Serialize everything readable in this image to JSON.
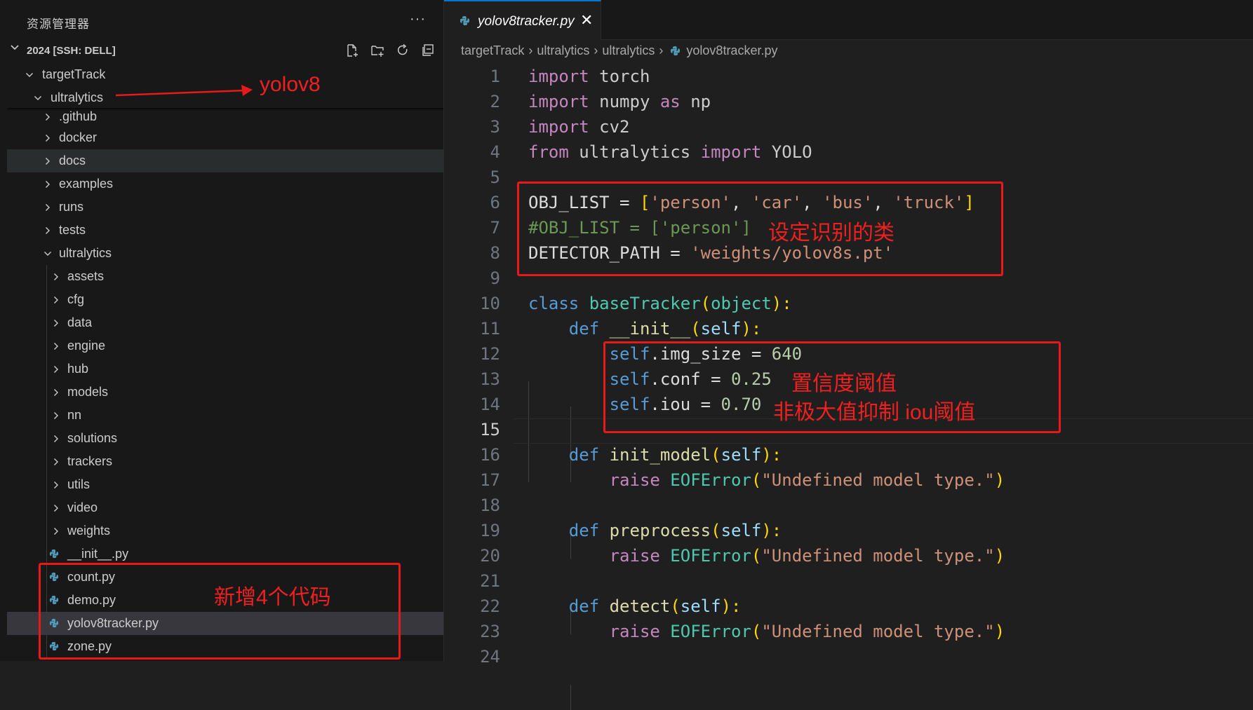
{
  "sidebar": {
    "title": "资源管理器",
    "more": "···",
    "section": "2024 [SSH: DELL]",
    "tree": [
      {
        "label": "targetTrack",
        "expanded": true
      },
      {
        "label": "ultralytics",
        "expanded": true
      },
      {
        "label": ".github"
      },
      {
        "label": "docker"
      },
      {
        "label": "docs"
      },
      {
        "label": "examples"
      },
      {
        "label": "runs"
      },
      {
        "label": "tests"
      },
      {
        "label": "ultralytics",
        "expanded": true
      },
      {
        "label": "assets"
      },
      {
        "label": "cfg"
      },
      {
        "label": "data"
      },
      {
        "label": "engine"
      },
      {
        "label": "hub"
      },
      {
        "label": "models"
      },
      {
        "label": "nn"
      },
      {
        "label": "solutions"
      },
      {
        "label": "trackers"
      },
      {
        "label": "utils"
      },
      {
        "label": "video"
      },
      {
        "label": "weights"
      },
      {
        "label": "__init__.py"
      },
      {
        "label": "count.py"
      },
      {
        "label": "demo.py"
      },
      {
        "label": "yolov8tracker.py"
      },
      {
        "label": "zone.py"
      }
    ]
  },
  "editor": {
    "tab": {
      "label": "yolov8tracker.py",
      "close": "✕"
    },
    "breadcrumb": [
      "targetTrack",
      "ultralytics",
      "ultralytics",
      "yolov8tracker.py"
    ],
    "lines": [
      "1",
      "2",
      "3",
      "4",
      "5",
      "6",
      "7",
      "8",
      "9",
      "10",
      "11",
      "12",
      "13",
      "14",
      "15",
      "16",
      "17",
      "18",
      "19",
      "20",
      "21",
      "22",
      "23",
      "24"
    ],
    "code": {
      "l1a": "import",
      "l1b": " torch",
      "l2a": "import",
      "l2b": " numpy ",
      "l2c": "as",
      "l2d": " np",
      "l3a": "import",
      "l3b": " cv2",
      "l4a": "from",
      "l4b": " ultralytics ",
      "l4c": "import",
      "l4d": " YOLO",
      "l6a": "OBJ_LIST = ",
      "l6b": "[",
      "l6c": "'person'",
      "l6d": ", ",
      "l6e": "'car'",
      "l6f": ", ",
      "l6g": "'bus'",
      "l6h": ", ",
      "l6i": "'truck'",
      "l6j": "]",
      "l7": "#OBJ_LIST = ['person']",
      "l8a": "DETECTOR_PATH = ",
      "l8b": "'weights/yolov8s.pt'",
      "l10a": "class",
      "l10b": " baseTracker",
      "l10c": "(",
      "l10d": "object",
      "l10e": "):",
      "l11a": "def",
      "l11b": " __init__",
      "l11c": "(",
      "l11d": "self",
      "l11e": "):",
      "l12a": "self",
      "l12b": ".img_size = ",
      "l12c": "640",
      "l13a": "self",
      "l13b": ".conf = ",
      "l13c": "0.25",
      "l14a": "self",
      "l14b": ".iou = ",
      "l14c": "0.70",
      "l16a": "def",
      "l16b": " init_model",
      "l16c": "(",
      "l16d": "self",
      "l16e": "):",
      "l17a": "raise",
      "l17b": " EOFError",
      "l17c": "(",
      "l17d": "\"Undefined model type.\"",
      "l17e": ")",
      "l19a": "def",
      "l19b": " preprocess",
      "l19c": "(",
      "l19d": "self",
      "l19e": "):",
      "l20a": "raise",
      "l20b": " EOFError",
      "l20c": "(",
      "l20d": "\"Undefined model type.\"",
      "l20e": ")",
      "l22a": "def",
      "l22b": " detect",
      "l22c": "(",
      "l22d": "self",
      "l22e": "):",
      "l23a": "raise",
      "l23b": " EOFError",
      "l23c": "(",
      "l23d": "\"Undefined model type.\"",
      "l23e": ")"
    }
  },
  "annotations": {
    "yolov8": "yolov8",
    "classes": "设定识别的类",
    "conf": "置信度阈值",
    "iou": "非极大值抑制 iou阈值",
    "new_files": "新增4个代码",
    "color": "#e81919"
  }
}
